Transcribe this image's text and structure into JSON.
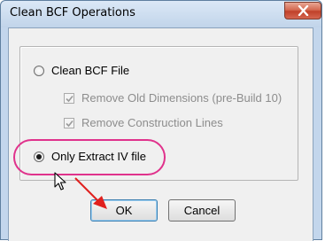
{
  "window": {
    "title": "Clean BCF Operations"
  },
  "options": {
    "clean_label": "Clean BCF File",
    "remove_dimensions_label": "Remove Old Dimensions (pre-Build 10)",
    "remove_lines_label": "Remove Construction Lines",
    "extract_label": "Only Extract IV file",
    "selected": "Only Extract IV file"
  },
  "buttons": {
    "ok_label": "OK",
    "cancel_label": "Cancel"
  },
  "icons": {
    "close": "close-icon",
    "check": "checkmark-icon",
    "cursor": "mouse-pointer-icon"
  },
  "colors": {
    "highlight": "#e0328c",
    "annotation_arrow": "#e0201e"
  }
}
